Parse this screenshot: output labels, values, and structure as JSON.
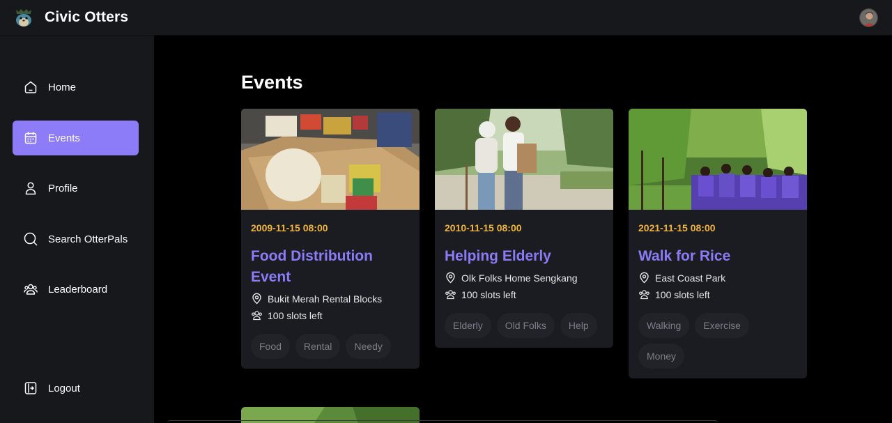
{
  "app": {
    "brand": "Civic Otters"
  },
  "sidebar": {
    "items": [
      {
        "label": "Home",
        "icon": "home-icon",
        "active": false
      },
      {
        "label": "Events",
        "icon": "calendar-icon",
        "active": true
      },
      {
        "label": "Profile",
        "icon": "user-icon",
        "active": false
      },
      {
        "label": "Search OtterPals",
        "icon": "search-icon",
        "active": false
      },
      {
        "label": "Leaderboard",
        "icon": "users-icon",
        "active": false
      }
    ],
    "logout": {
      "label": "Logout",
      "icon": "logout-icon"
    }
  },
  "main": {
    "title": "Events",
    "events": [
      {
        "date": "2009-11-15 08:00",
        "title": "Food Distribution Event",
        "location": "Bukit Merah Rental Blocks",
        "slots": "100 slots left",
        "tags": [
          "Food",
          "Rental",
          "Needy"
        ]
      },
      {
        "date": "2010-11-15 08:00",
        "title": "Helping Elderly",
        "location": "Olk Folks Home Sengkang",
        "slots": "100 slots left",
        "tags": [
          "Elderly",
          "Old Folks",
          "Help"
        ]
      },
      {
        "date": "2021-11-15 08:00",
        "title": "Walk for Rice",
        "location": "East Coast Park",
        "slots": "100 slots left",
        "tags": [
          "Walking",
          "Exercise",
          "Money"
        ]
      }
    ]
  },
  "colors": {
    "accent": "#8c7cf7",
    "date": "#f0b43c",
    "title": "#8a7cf6",
    "card_bg": "#1b1c21",
    "sidebar_bg": "#17181c"
  }
}
